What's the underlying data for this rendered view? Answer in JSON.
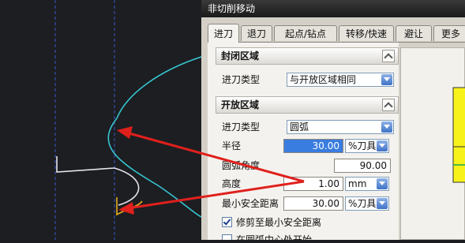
{
  "dialog": {
    "title": "非切削移动",
    "tabs": [
      {
        "label": "进刀",
        "active": true
      },
      {
        "label": "退刀"
      },
      {
        "label": "起点/钻点"
      },
      {
        "label": "转移/快速"
      },
      {
        "label": "避让"
      },
      {
        "label": "更多"
      }
    ]
  },
  "closed_region": {
    "header": "封闭区域",
    "engage_type_label": "进刀类型",
    "engage_type_value": "与开放区域相同"
  },
  "open_region": {
    "header": "开放区域",
    "engage_type_label": "进刀类型",
    "engage_type_value": "圆弧",
    "radius_label": "半径",
    "radius_value": "30.00",
    "radius_unit": "%刀具",
    "arc_angle_label": "圆弧角度",
    "arc_angle_value": "90.00",
    "height_label": "高度",
    "height_value": "1.00",
    "height_unit": "mm",
    "min_clearance_label": "最小安全距离",
    "min_clearance_value": "30.00",
    "min_clearance_unit": "%刀具",
    "trim_checkbox_label": "修剪至最小安全距离",
    "trim_checked": true,
    "arc_center_checkbox_label": "在圆弧中心处开始",
    "arc_center_checked": false
  },
  "colors": {
    "dialog_bg": "#d4d0c8",
    "panel_bg": "#f4f2ee",
    "viewport_bg": "#1c1e22",
    "toolpath_cyan": "#36c6d0",
    "arrow_red": "#e0201c",
    "preview_yellow": "#f7f21a"
  }
}
